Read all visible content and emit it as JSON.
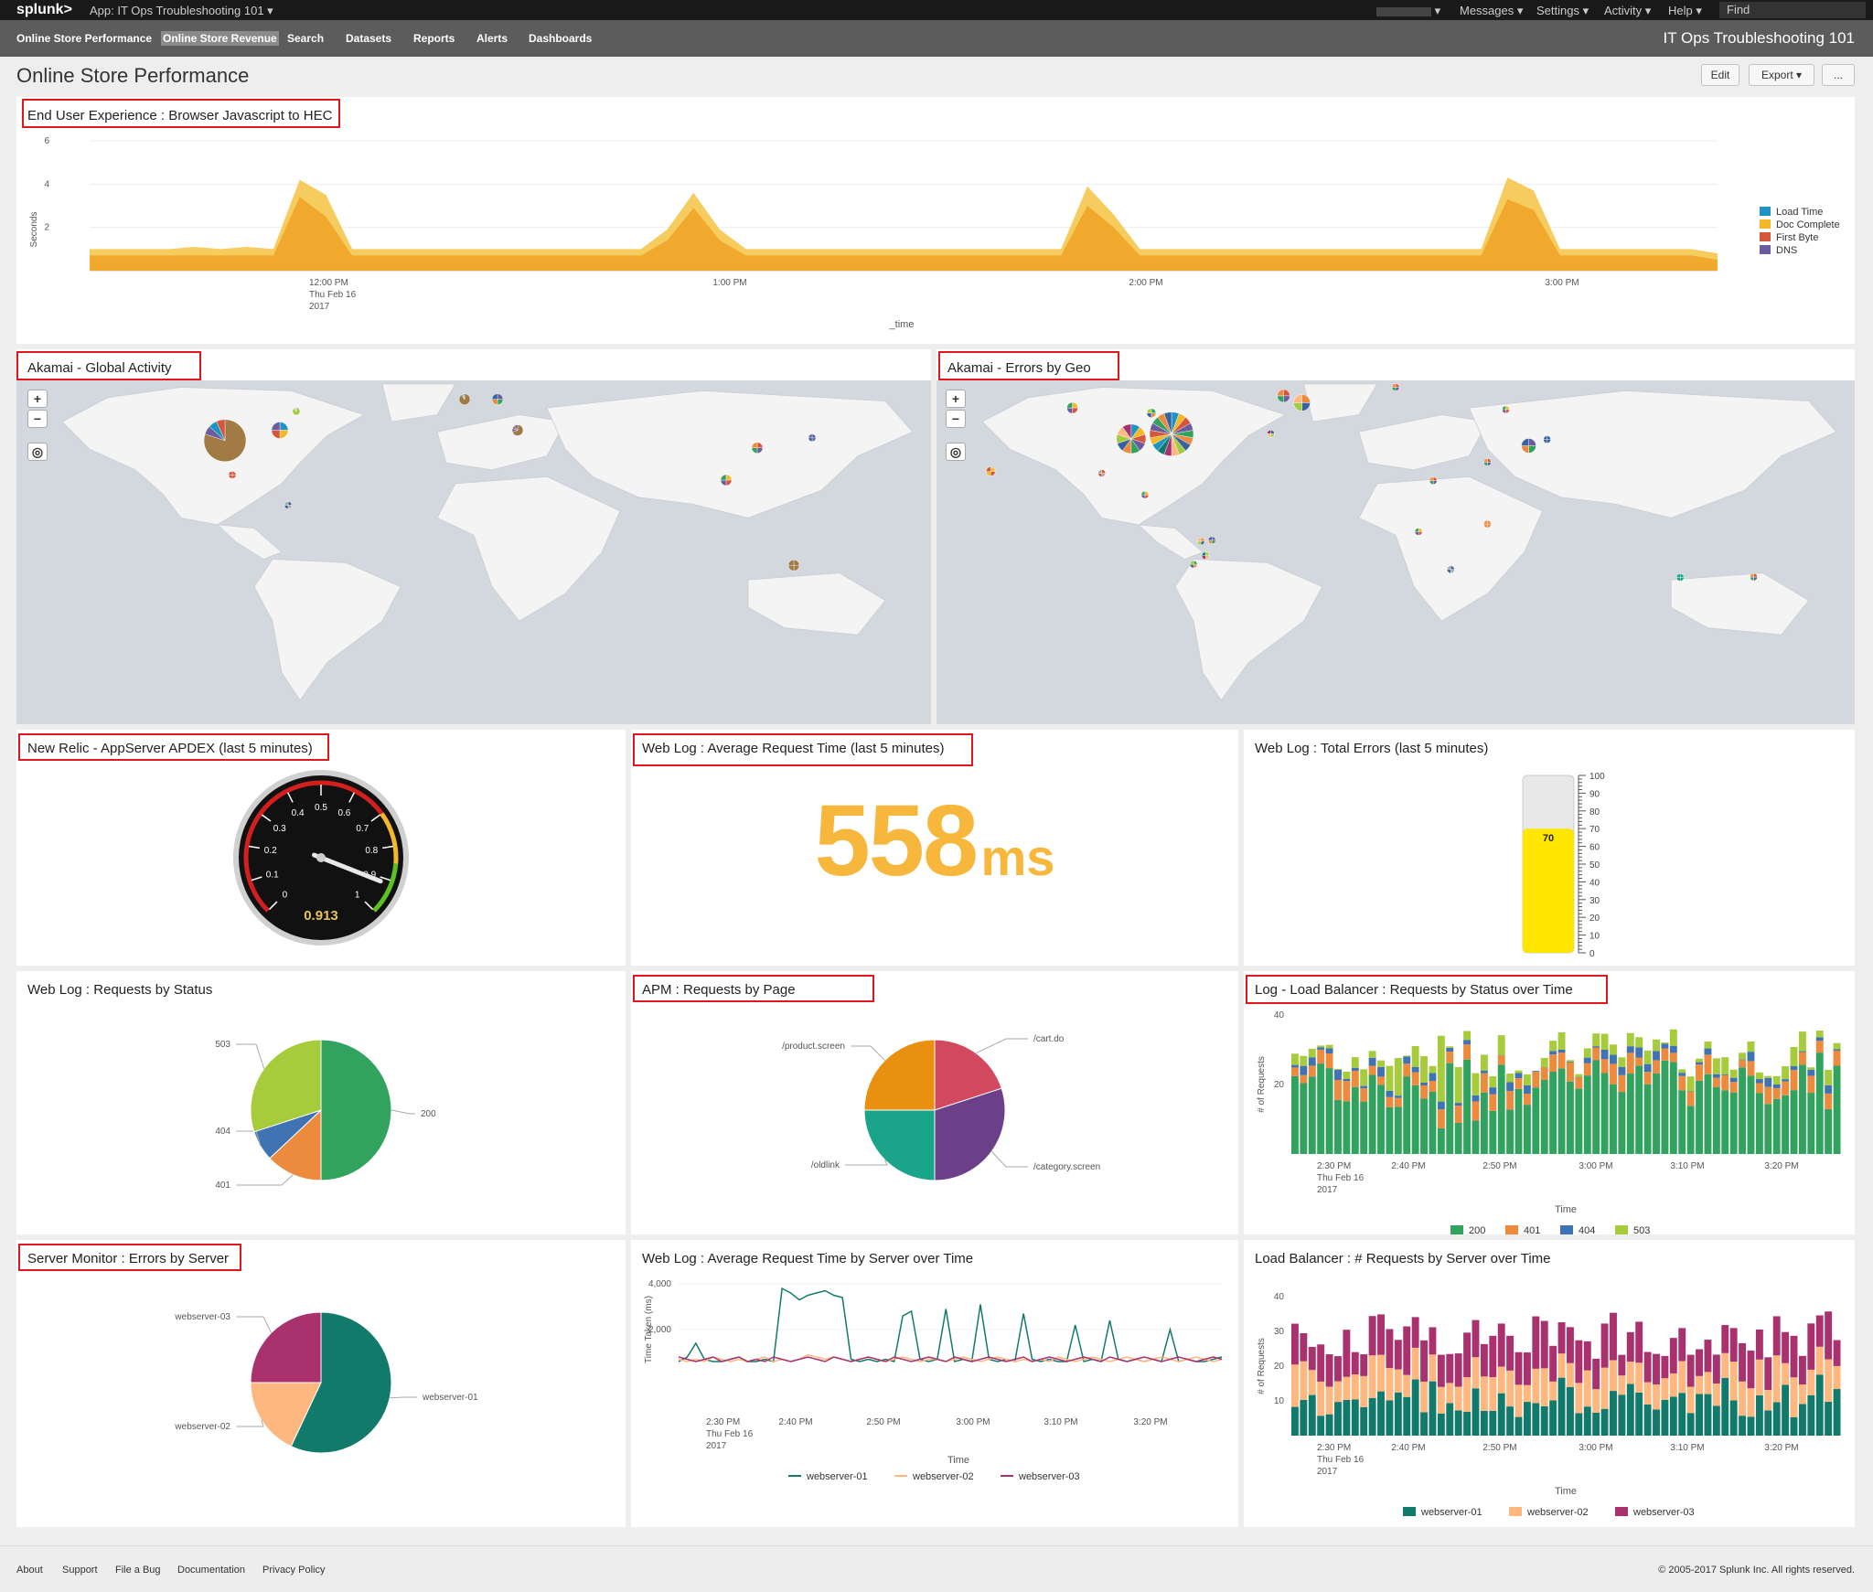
{
  "topbar": {
    "logo": "splunk>",
    "app_label": "App: IT Ops Troubleshooting 101 ▾",
    "user": "▾",
    "messages": "Messages ▾",
    "settings": "Settings ▾",
    "activity": "Activity ▾",
    "help": "Help ▾",
    "find": "Find"
  },
  "nav": {
    "items": [
      "Online Store Performance",
      "Online Store Revenue",
      "Search",
      "Datasets",
      "Reports",
      "Alerts",
      "Dashboards"
    ],
    "app_title": "IT Ops Troubleshooting 101"
  },
  "page": {
    "title": "Online Store Performance",
    "edit": "Edit",
    "export": "Export ▾",
    "more": "..."
  },
  "panels": {
    "eue": "End User Experience : Browser Javascript to HEC",
    "akamai_global": "Akamai - Global Activity",
    "akamai_errors": "Akamai - Errors by Geo",
    "apdex": "New Relic - AppServer APDEX (last 5 minutes)",
    "avg_req": "Web Log : Average Request Time (last 5 minutes)",
    "total_errors": "Web Log : Total Errors (last 5 minutes)",
    "req_status": "Web Log : Requests by Status",
    "apm": "APM : Requests by Page",
    "lb_status": "Log - Load Balancer : Requests by Status over Time",
    "srv_errors": "Server Monitor : Errors by Server",
    "avg_req_srv": "Web Log : Average Request Time by Server over Time",
    "lb_srv": "Load Balancer : # Requests by Server over Time"
  },
  "singles": {
    "avg_req_value": "558",
    "avg_req_unit": "ms",
    "apdex_value": "0.913",
    "total_errors_value": "70"
  },
  "map_controls": {
    "zoom_in": "+",
    "zoom_out": "−"
  },
  "footer": {
    "links": [
      "About",
      "Support",
      "File a Bug",
      "Documentation",
      "Privacy Policy"
    ],
    "copyright": "© 2005-2017 Splunk Inc. All rights reserved."
  },
  "colors": {
    "topbar": "#1a1a1a",
    "navbar": "#5c5c5c",
    "highlight": "#e0181e",
    "single_value": "#f6b73c",
    "gauge_fill": "#ffe600"
  },
  "chart_data": [
    {
      "id": "eue",
      "type": "area",
      "ylabel": "Seconds",
      "xlabel": "_time",
      "ylim": [
        0,
        6
      ],
      "yticks": [
        2,
        4,
        6
      ],
      "xtick_labels": [
        "12:00 PM\nThu Feb 16\n2017",
        "1:00 PM",
        "2:00 PM",
        "3:00 PM"
      ],
      "legend": [
        "Load Time",
        "Doc Complete",
        "First Byte",
        "DNS"
      ],
      "legend_colors": [
        "#1e93c6",
        "#f2b827",
        "#d6563c",
        "#6a5c9e"
      ],
      "series": [
        {
          "name": "Doc Complete",
          "values": [
            1.0,
            1.0,
            1.0,
            1.0,
            1.1,
            1.0,
            1.1,
            1.0,
            4.2,
            3.5,
            1.0,
            1.0,
            1.0,
            1.0,
            1.0,
            1.0,
            1.0,
            1.0,
            1.0,
            1.0,
            1.0,
            1.0,
            1.9,
            3.6,
            1.9,
            1.0,
            1.0,
            1.0,
            1.0,
            1.0,
            1.0,
            1.0,
            1.0,
            1.0,
            1.0,
            1.0,
            1.0,
            1.0,
            3.9,
            2.6,
            1.0,
            1.0,
            1.0,
            1.0,
            1.0,
            1.0,
            1.0,
            1.0,
            1.0,
            1.0,
            1.0,
            1.0,
            1.0,
            1.0,
            4.3,
            3.7,
            1.0,
            1.0,
            1.0,
            1.0,
            1.0,
            1.0,
            0.8
          ]
        },
        {
          "name": "Load Time",
          "values": [
            0.7,
            0.7,
            0.7,
            0.7,
            0.7,
            0.7,
            0.7,
            0.7,
            3.4,
            2.5,
            0.7,
            0.7,
            0.7,
            0.7,
            0.7,
            0.7,
            0.7,
            0.7,
            0.7,
            0.7,
            0.7,
            0.7,
            1.4,
            2.9,
            1.4,
            0.7,
            0.7,
            0.7,
            0.7,
            0.7,
            0.7,
            0.7,
            0.7,
            0.7,
            0.7,
            0.7,
            0.7,
            0.7,
            3.0,
            2.0,
            0.7,
            0.7,
            0.7,
            0.7,
            0.7,
            0.7,
            0.7,
            0.7,
            0.7,
            0.7,
            0.7,
            0.7,
            0.7,
            0.7,
            3.3,
            2.8,
            0.7,
            0.7,
            0.7,
            0.7,
            0.7,
            0.7,
            0.5
          ]
        }
      ]
    },
    {
      "id": "req_status",
      "type": "pie",
      "categories": [
        "200",
        "401",
        "404",
        "503"
      ],
      "values": [
        50,
        13,
        7,
        30
      ],
      "colors": [
        "#31a35f",
        "#ec8a3e",
        "#3f73b3",
        "#a6cb3b"
      ]
    },
    {
      "id": "apm",
      "type": "pie",
      "categories": [
        "/cart.do",
        "/category.screen",
        "/oldlink",
        "/product.screen"
      ],
      "values": [
        20,
        30,
        25,
        25
      ],
      "colors": [
        "#d1485f",
        "#6c4088",
        "#1aa58a",
        "#ea9010"
      ]
    },
    {
      "id": "srv_errors",
      "type": "pie",
      "categories": [
        "webserver-01",
        "webserver-02",
        "webserver-03"
      ],
      "values": [
        57,
        18,
        25
      ],
      "colors": [
        "#127a6b",
        "#fdb77f",
        "#a8316e"
      ]
    },
    {
      "id": "total_errors",
      "type": "gauge",
      "value": 70,
      "range": [
        0,
        100
      ],
      "ticks": [
        0,
        10,
        20,
        30,
        40,
        50,
        60,
        70,
        80,
        90,
        100
      ]
    },
    {
      "id": "apdex",
      "type": "radial-gauge",
      "value": 0.913,
      "ticks": [
        0,
        0.1,
        0.2,
        0.3,
        0.4,
        0.5,
        0.6,
        0.7,
        0.8,
        0.9,
        1
      ]
    },
    {
      "id": "lb_status",
      "type": "bar",
      "stacked": true,
      "xlabel": "Time",
      "ylabel": "# of Requests",
      "ylim": [
        0,
        40
      ],
      "yticks": [
        20,
        40
      ],
      "xtick_labels": [
        "2:30 PM\nThu Feb 16\n2017",
        "2:40 PM",
        "2:50 PM",
        "3:00 PM",
        "3:10 PM",
        "3:20 PM"
      ],
      "legend": [
        "200",
        "401",
        "404",
        "503"
      ],
      "legend_colors": [
        "#31a35f",
        "#ec8a3e",
        "#3f73b3",
        "#a6cb3b"
      ]
    },
    {
      "id": "avg_req_srv",
      "type": "line",
      "xlabel": "Time",
      "ylabel": "Time Taken (ms)",
      "yticks": [
        "2,000",
        "4,000"
      ],
      "ylim": [
        0,
        4000
      ],
      "xtick_labels": [
        "2:30 PM\nThu Feb 16\n2017",
        "2:40 PM",
        "2:50 PM",
        "3:00 PM",
        "3:10 PM",
        "3:20 PM"
      ],
      "legend": [
        "webserver-01",
        "webserver-02",
        "webserver-03"
      ],
      "legend_colors": [
        "#127a6b",
        "#fdb77f",
        "#a8316e"
      ],
      "series": [
        {
          "name": "webserver-01",
          "values": [
            600,
            800,
            1400,
            700,
            600,
            600,
            700,
            800,
            600,
            600,
            700,
            600,
            3800,
            3600,
            3300,
            3500,
            3600,
            3700,
            3500,
            3400,
            700,
            600,
            700,
            600,
            700,
            600,
            2600,
            2800,
            700,
            600,
            700,
            2900,
            600,
            700,
            600,
            3100,
            700,
            600,
            700,
            600,
            2700,
            700,
            600,
            700,
            600,
            600,
            2200,
            600,
            700,
            600,
            2400,
            700,
            600,
            700,
            600,
            700,
            600,
            2000,
            600,
            700,
            600,
            600,
            700,
            800
          ]
        },
        {
          "name": "webserver-02",
          "values": [
            700,
            600,
            700,
            600,
            800,
            700,
            600,
            700,
            600,
            700,
            800,
            600,
            700,
            600,
            700,
            900,
            800,
            700,
            800,
            700,
            600,
            700,
            800,
            700,
            600,
            700,
            800,
            700,
            600,
            700,
            700,
            600,
            700,
            800,
            700,
            600,
            700,
            800,
            700,
            600,
            700,
            600,
            700,
            600,
            800,
            700,
            600,
            700,
            800,
            700,
            600,
            700,
            800,
            700,
            600,
            700,
            800,
            700,
            600,
            700,
            800,
            700,
            600,
            700
          ]
        },
        {
          "name": "webserver-03",
          "values": [
            800,
            700,
            600,
            700,
            800,
            600,
            700,
            800,
            600,
            700,
            600,
            800,
            700,
            600,
            700,
            800,
            700,
            600,
            800,
            700,
            600,
            700,
            800,
            700,
            600,
            800,
            700,
            600,
            700,
            800,
            700,
            600,
            800,
            700,
            600,
            700,
            800,
            700,
            600,
            700,
            800,
            600,
            700,
            800,
            700,
            600,
            700,
            800,
            700,
            600,
            800,
            700,
            600,
            700,
            800,
            700,
            600,
            700,
            800,
            700,
            600,
            700,
            800,
            700
          ]
        }
      ]
    },
    {
      "id": "lb_srv",
      "type": "bar",
      "stacked": true,
      "xlabel": "Time",
      "ylabel": "# of Requests",
      "ylim": [
        0,
        40
      ],
      "yticks": [
        10,
        20,
        30,
        40
      ],
      "xtick_labels": [
        "2:30 PM\nThu Feb 16\n2017",
        "2:40 PM",
        "2:50 PM",
        "3:00 PM",
        "3:10 PM",
        "3:20 PM"
      ],
      "legend": [
        "webserver-01",
        "webserver-02",
        "webserver-03"
      ],
      "legend_colors": [
        "#127a6b",
        "#fdb77f",
        "#a8316e"
      ]
    }
  ]
}
